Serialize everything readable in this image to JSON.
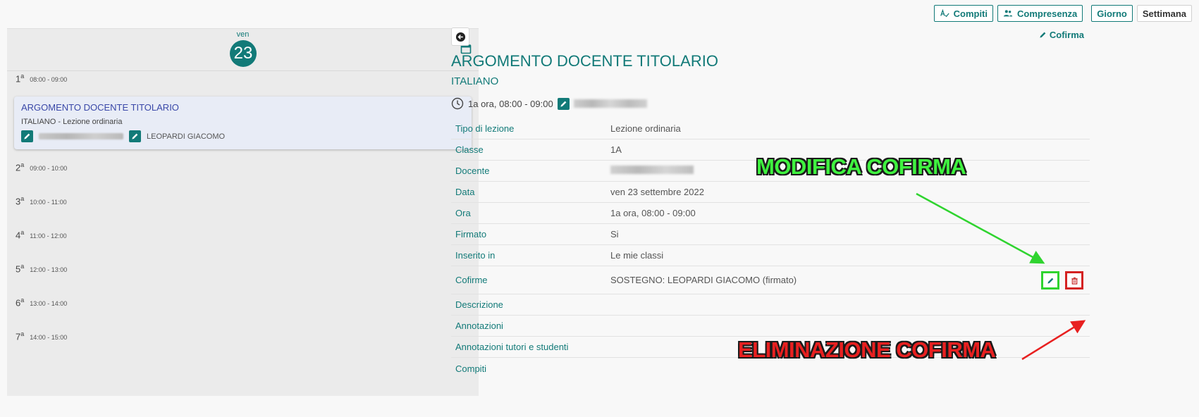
{
  "toolbar": {
    "compiti_label": "Compiti",
    "compresenza_label": "Compresenza",
    "giorno_label": "Giorno",
    "settimana_label": "Settimana"
  },
  "calendar": {
    "day_name": "ven",
    "day_number": "23",
    "slots": [
      {
        "num": "1",
        "sup": "a",
        "time": "08:00 - 09:00"
      },
      {
        "num": "2",
        "sup": "a",
        "time": "09:00 - 10:00"
      },
      {
        "num": "3",
        "sup": "a",
        "time": "10:00 - 11:00"
      },
      {
        "num": "4",
        "sup": "a",
        "time": "11:00 - 12:00"
      },
      {
        "num": "5",
        "sup": "a",
        "time": "12:00 - 13:00"
      },
      {
        "num": "6",
        "sup": "a",
        "time": "13:00 - 14:00"
      },
      {
        "num": "7",
        "sup": "a",
        "time": "14:00 - 15:00"
      }
    ],
    "lesson": {
      "title": "ARGOMENTO DOCENTE TITOLARIO",
      "subtitle": "ITALIANO - Lezione ordinaria",
      "cosigner": "LEOPARDI GIACOMO"
    }
  },
  "detail": {
    "cofirma_link": "Cofirma",
    "title": "ARGOMENTO DOCENTE TITOLARIO",
    "subject": "ITALIANO",
    "time_summary": "1a ora, 08:00 - 09:00",
    "rows": [
      {
        "label": "Tipo di lezione",
        "value": "Lezione ordinaria"
      },
      {
        "label": "Classe",
        "value": "1A"
      },
      {
        "label": "Docente",
        "value": ""
      },
      {
        "label": "Data",
        "value": "ven 23 settembre 2022"
      },
      {
        "label": "Ora",
        "value": "1a ora, 08:00 - 09:00"
      },
      {
        "label": "Firmato",
        "value": "Si"
      },
      {
        "label": "Inserito in",
        "value": "Le mie classi"
      },
      {
        "label": "Cofirme",
        "value": "SOSTEGNO: LEOPARDI GIACOMO (firmato)"
      },
      {
        "label": "Descrizione",
        "value": ""
      },
      {
        "label": "Annotazioni",
        "value": ""
      },
      {
        "label": "Annotazioni tutori e studenti",
        "value": ""
      },
      {
        "label": "Compiti",
        "value": ""
      }
    ]
  },
  "annotations": {
    "edit": "MODIFICA COFIRMA",
    "delete": "ELIMINAZIONE COFIRMA"
  },
  "colors": {
    "accent": "#127a78",
    "highlight_edit": "#2fd42f",
    "highlight_delete": "#d42222"
  }
}
